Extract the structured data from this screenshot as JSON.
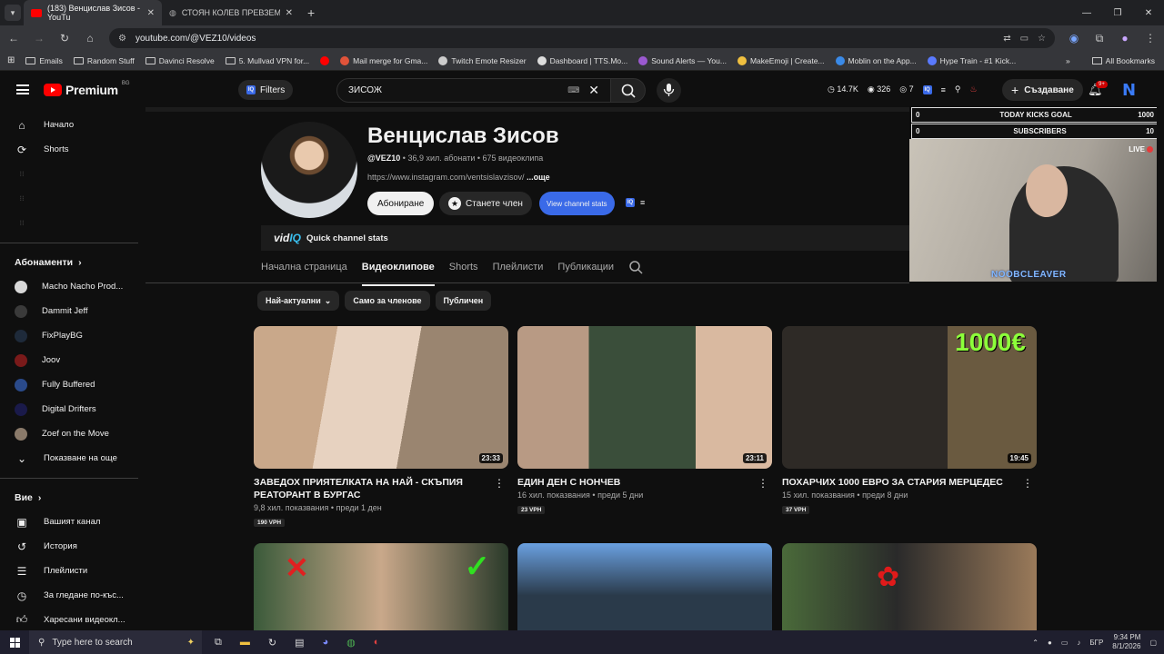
{
  "browser": {
    "tabs": [
      {
        "title": "(183) Венцислав Зисов - YouTu",
        "active": true
      },
      {
        "title": "СТОЯН КОЛЕВ ПРЕВЗЕМА ТИ",
        "active": false
      }
    ],
    "new_tab": "+",
    "window_controls": [
      "—",
      "❐",
      "✕"
    ],
    "url": "youtube.com/@VEZ10/videos",
    "bookmarks": [
      {
        "label": "Emails",
        "icon": "folder-icon"
      },
      {
        "label": "Random Stuff",
        "icon": "folder-icon"
      },
      {
        "label": "Davinci Resolve",
        "icon": "folder-icon"
      },
      {
        "label": "5. Mullvad VPN for...",
        "icon": "folder-icon"
      },
      {
        "label": "",
        "icon": "youtube-icon"
      },
      {
        "label": "Mail merge for Gma...",
        "icon": "mail-icon"
      },
      {
        "label": "Twitch Emote Resizer",
        "icon": "twitch-icon"
      },
      {
        "label": "Dashboard | TTS.Mo...",
        "icon": "tts-icon"
      },
      {
        "label": "Sound Alerts — You...",
        "icon": "sound-icon"
      },
      {
        "label": "MakeEmoji | Create...",
        "icon": "emoji-icon"
      },
      {
        "label": "Moblin on the App...",
        "icon": "app-icon"
      },
      {
        "label": "Hype Train - #1 Kick...",
        "icon": "hype-icon"
      }
    ],
    "all_bookmarks": "All Bookmarks"
  },
  "youtube": {
    "logo_text": "Premium",
    "logo_region": "BG",
    "filters_label": "Filters",
    "search_value": "ЗИСОЖ",
    "header_stats": {
      "views": "14.7K",
      "watch": "326",
      "likes": "7"
    },
    "create_label": "Създаване",
    "notif_badge": "9+",
    "avatar_letter": "N"
  },
  "sidebar": {
    "main": [
      {
        "label": "Начало",
        "icon": "home-icon"
      },
      {
        "label": "Shorts",
        "icon": "shorts-icon"
      }
    ],
    "subscriptions_header": "Абонаменти",
    "subscriptions": [
      {
        "label": "Macho Nacho Prod...",
        "color": "#d8d8d8"
      },
      {
        "label": "Dammit Jeff",
        "color": "#3a3a3a"
      },
      {
        "label": "FixPlayBG",
        "color": "#1e2a3a"
      },
      {
        "label": "Joov",
        "color": "#7a1a1a"
      },
      {
        "label": "Fully Buffered",
        "color": "#2a4a8a"
      },
      {
        "label": "Digital Drifters",
        "color": "#1a1a4a"
      },
      {
        "label": "Zoef on the Move",
        "color": "#8a7a6a"
      }
    ],
    "show_more": "Показване на още",
    "you_header": "Вие",
    "you_items": [
      {
        "label": "Вашият канал",
        "icon": "channel-icon"
      },
      {
        "label": "История",
        "icon": "history-icon"
      },
      {
        "label": "Плейлисти",
        "icon": "playlist-icon"
      },
      {
        "label": "За гледане по-къс...",
        "icon": "watch-later-icon"
      },
      {
        "label": "Харесани видеокл...",
        "icon": "like-icon"
      }
    ]
  },
  "channel": {
    "name": "Венцислав Зисов",
    "handle": "@VEZ10",
    "subscribers": "36,9 хил. абонати",
    "video_count": "675 видеоклипа",
    "link": "https://www.instagram.com/ventsislavzisov/",
    "more": "...още",
    "subscribe_label": "Абониране",
    "join_label": "Станете член",
    "stats_label": "View channel stats",
    "vidiq_label": "Quick channel stats",
    "tabs": [
      "Начална страница",
      "Видеоклипове",
      "Shorts",
      "Плейлисти",
      "Публикации"
    ],
    "active_tab": "Видеоклипове"
  },
  "chips": [
    {
      "label": "Най-актуални",
      "dropdown": true
    },
    {
      "label": "Само за членове",
      "dropdown": false
    },
    {
      "label": "Публичен",
      "dropdown": false
    }
  ],
  "videos": [
    {
      "title": "ЗАВЕДОХ ПРИЯТЕЛКАТА НА НАЙ - СКЪПИЯ РЕАТОРАНТ В БУРГАС",
      "views": "9,8 хил. показвания",
      "age": "преди 1 ден",
      "vph": "190 VPH",
      "duration": "23:33"
    },
    {
      "title": "ЕДИН ДЕН С НОНЧЕВ",
      "views": "16 хил. показвания",
      "age": "преди 5 дни",
      "vph": "23 VPH",
      "duration": "23:11"
    },
    {
      "title": "ПОХАРЧИХ 1000 ЕВРО ЗА СТАРИЯ МЕРЦЕДЕС",
      "views": "15 хил. показвания",
      "age": "преди 8 дни",
      "vph": "37 VPH",
      "duration": "19:45",
      "overlay_text": "1000€"
    }
  ],
  "stream_overlay": {
    "goal_rows": [
      {
        "left": "0",
        "label": "TODAY KICKS GOAL",
        "right": "1000"
      },
      {
        "left": "0",
        "label": "SUBSCRIBERS",
        "right": "10"
      }
    ],
    "live_label": "LIVE",
    "streamer_name": "NOOBCLEAVER"
  },
  "taskbar": {
    "search_placeholder": "Type here to search",
    "lang": "БГР",
    "time": "9:34 PM",
    "date": "8/1/2026"
  }
}
